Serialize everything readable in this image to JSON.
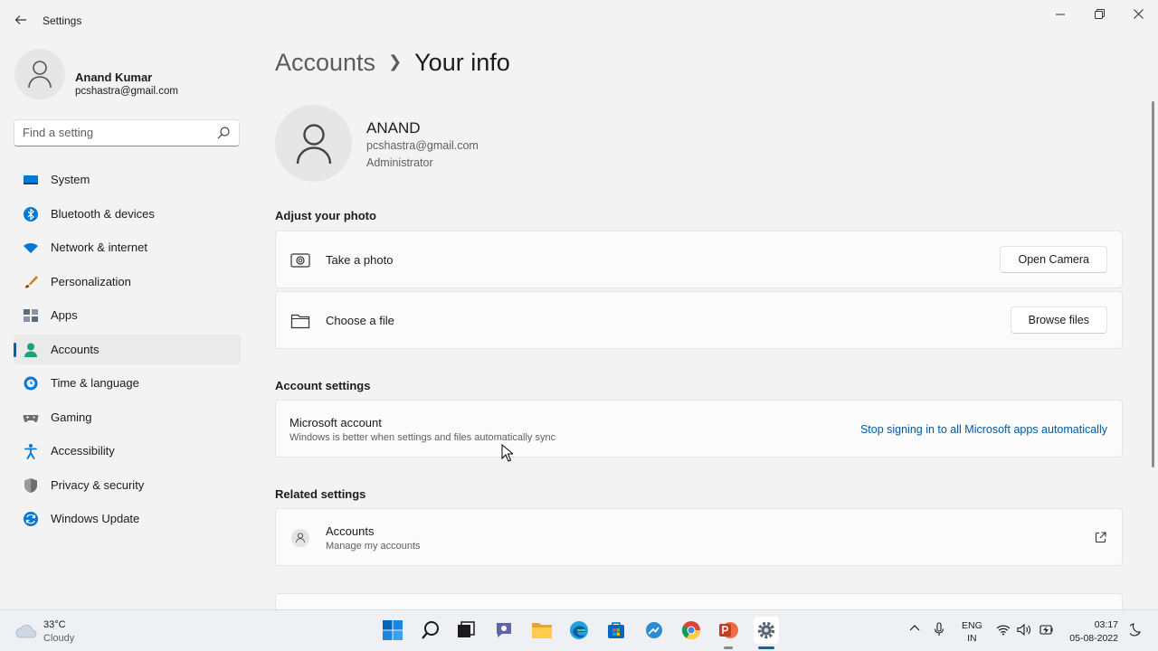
{
  "window": {
    "title": "Settings",
    "back_icon": "back-arrow-icon",
    "controls": [
      "minimize",
      "restore",
      "close"
    ]
  },
  "sidebar": {
    "profile": {
      "name": "Anand Kumar",
      "email": "pcshastra@gmail.com"
    },
    "search": {
      "placeholder": "Find a setting"
    },
    "items": [
      {
        "label": "System",
        "icon": "system-icon",
        "color": "#0078d4"
      },
      {
        "label": "Bluetooth & devices",
        "icon": "bluetooth-icon",
        "color": "#0078d4"
      },
      {
        "label": "Network & internet",
        "icon": "wifi-icon",
        "color": "#0078d4"
      },
      {
        "label": "Personalization",
        "icon": "brush-icon",
        "color": "#d47b1f"
      },
      {
        "label": "Apps",
        "icon": "apps-icon",
        "color": "#5f6b7a"
      },
      {
        "label": "Accounts",
        "icon": "person-icon",
        "color": "#1aa37a",
        "active": true
      },
      {
        "label": "Time & language",
        "icon": "clock-globe-icon",
        "color": "#0078d4"
      },
      {
        "label": "Gaming",
        "icon": "gamepad-icon",
        "color": "#6e6e6e"
      },
      {
        "label": "Accessibility",
        "icon": "accessibility-icon",
        "color": "#0078d4"
      },
      {
        "label": "Privacy & security",
        "icon": "shield-icon",
        "color": "#6e6e6e"
      },
      {
        "label": "Windows Update",
        "icon": "update-icon",
        "color": "#0078d4"
      }
    ]
  },
  "main": {
    "breadcrumb": {
      "parent": "Accounts",
      "current": "Your info"
    },
    "user": {
      "name": "ANAND",
      "email": "pcshastra@gmail.com",
      "role": "Administrator"
    },
    "adjust_photo": {
      "title": "Adjust your photo",
      "take_photo": {
        "label": "Take a photo",
        "button": "Open Camera"
      },
      "choose_file": {
        "label": "Choose a file",
        "button": "Browse files"
      }
    },
    "account_settings": {
      "title": "Account settings",
      "microsoft_account": {
        "label": "Microsoft account",
        "description": "Windows is better when settings and files automatically sync",
        "link": "Stop signing in to all Microsoft apps automatically"
      }
    },
    "related_settings": {
      "title": "Related settings",
      "accounts": {
        "label": "Accounts",
        "description": "Manage my accounts"
      }
    }
  },
  "taskbar": {
    "weather": {
      "temp": "33°C",
      "condition": "Cloudy"
    },
    "apps": [
      "start-icon",
      "search-icon",
      "task-view-icon",
      "teams-icon",
      "file-explorer-icon",
      "edge-icon",
      "store-icon",
      "photos-icon",
      "chrome-icon",
      "powerpoint-icon",
      "settings-icon"
    ],
    "language": {
      "line1": "ENG",
      "line2": "IN"
    },
    "clock": {
      "time": "03:17",
      "date": "05-08-2022"
    }
  },
  "colors": {
    "accent": "#005fb8",
    "link": "#005a9e",
    "background": "#f3f3f3",
    "card": "#fbfbfb"
  }
}
